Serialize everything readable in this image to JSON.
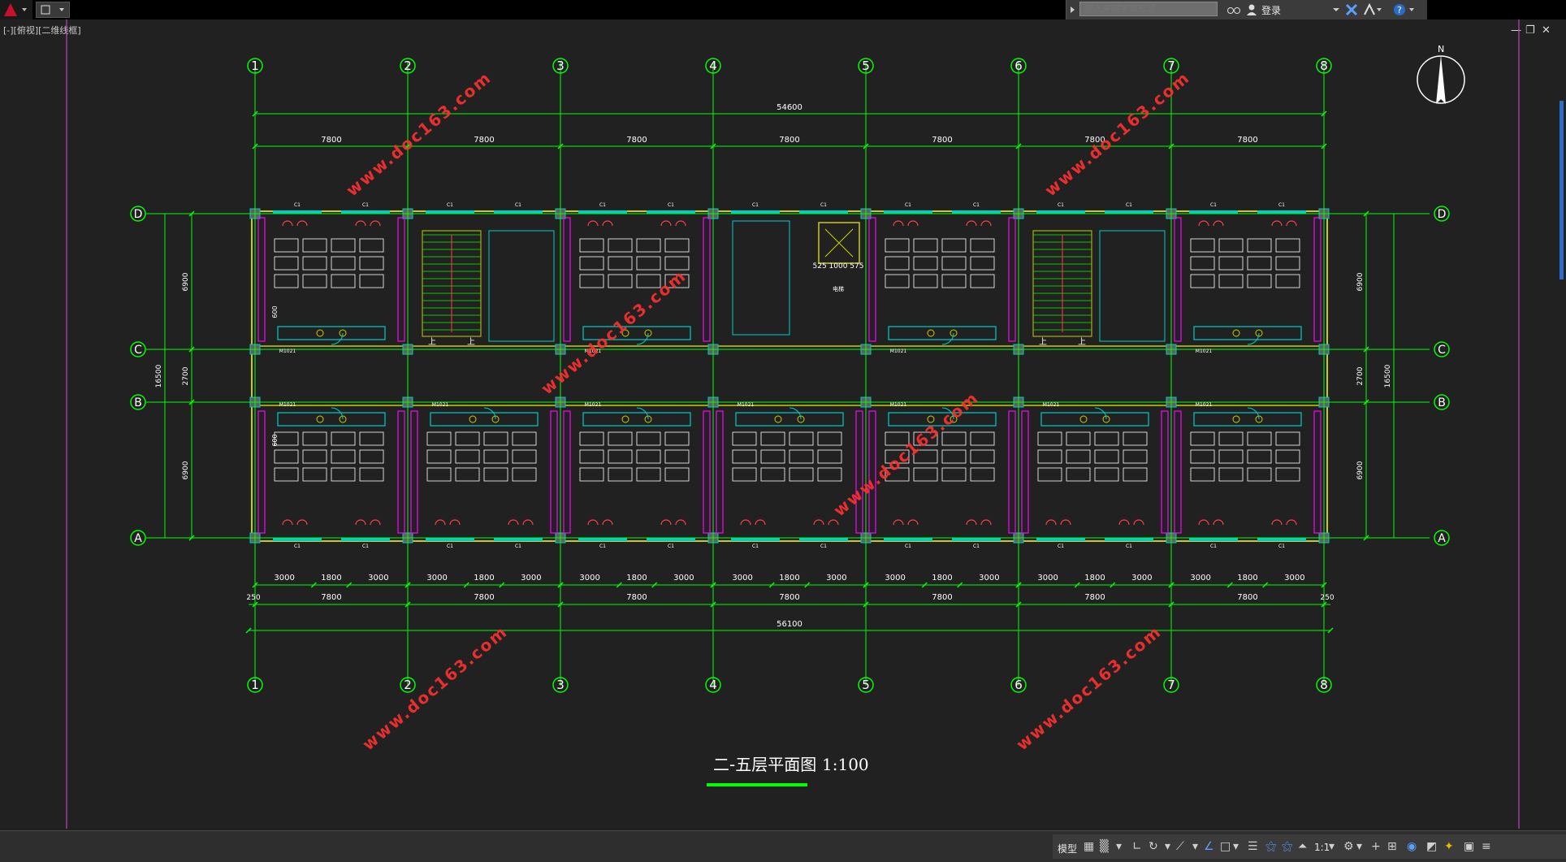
{
  "titlebar": {
    "search_placeholder": "键入关键字或短语",
    "login_label": "登录"
  },
  "viewport": {
    "view_label": "[-][俯视][二维线框]"
  },
  "drawing": {
    "title": "二-五层平面图",
    "scale": "1:100",
    "watermark": "www.doc163.com",
    "north_label": "N",
    "grid_x_labels": [
      "1",
      "2",
      "3",
      "4",
      "5",
      "6",
      "7",
      "8"
    ],
    "grid_y_labels": [
      "D",
      "C",
      "B",
      "A"
    ],
    "top_total_dim": "54600",
    "bay_dim": "7800",
    "bottom_total_dim": "56100",
    "edge_dim": "250",
    "sub_dims": [
      "3000",
      "1800",
      "3000"
    ],
    "left_dims": [
      "6900",
      "2700",
      "6900"
    ],
    "left_total_dim": "16500",
    "room_width_dim": "600",
    "elevator_dims": "525 1000 575",
    "elevator_label": "电梯",
    "stair_label": "上",
    "door_tag": "M1021",
    "window_tag": "C1"
  },
  "statusbar": {
    "model_label": "模型",
    "annotation_scale": "1:1"
  },
  "colors": {
    "grid": "#00ff00",
    "wall": "#cccc00",
    "fixture": "#00cccc",
    "furniture": "#ff4040",
    "magenta": "#ff00ff",
    "watermark": "#ff3030"
  }
}
